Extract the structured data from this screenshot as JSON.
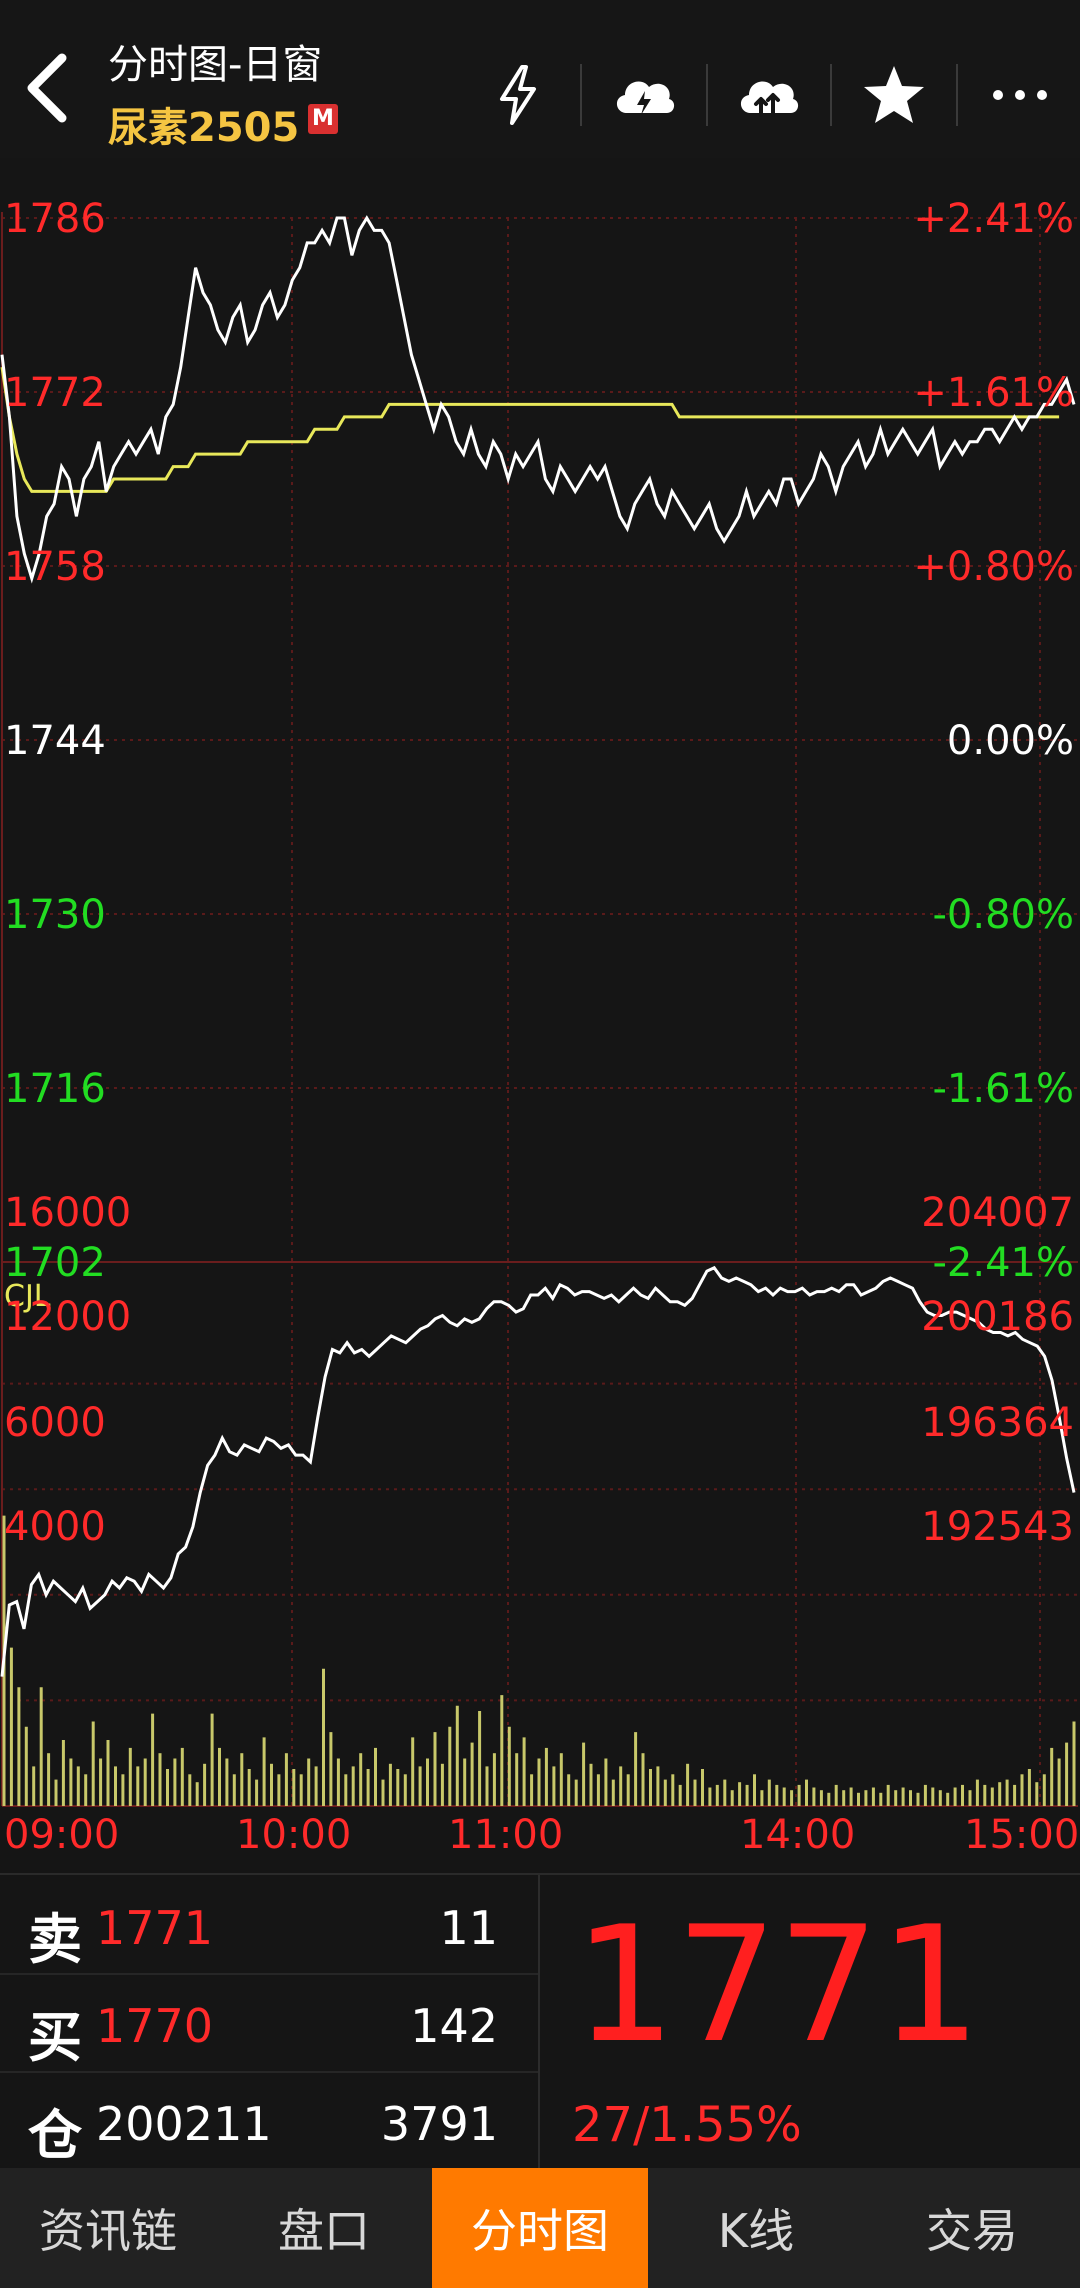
{
  "header": {
    "title": "分时图-日窗",
    "symbol": "尿素2505",
    "badge": "M",
    "icons": [
      "back-icon",
      "lightning-icon",
      "cloud-download-icon",
      "cloud-upload-icon",
      "star-icon",
      "more-icon"
    ]
  },
  "colors": {
    "background": "#151515",
    "up": "#ff2a2a",
    "down": "#22dd22",
    "neutral": "#ffffff",
    "avg_line": "#e8e85a",
    "accent": "#ff7a00",
    "symbol": "#f5c542"
  },
  "chart_data": [
    {
      "type": "line",
      "name": "price-chart",
      "y_ticks": [
        "1786",
        "1772",
        "1758",
        "1744",
        "1730",
        "1716",
        "1702"
      ],
      "right_ticks": [
        "+2.41%",
        "+1.61%",
        "+0.80%",
        "0.00%",
        "-0.80%",
        "-1.61%",
        "-2.41%"
      ],
      "ylim": [
        1702,
        1786
      ],
      "prev_settle": 1744,
      "x_ticks": [
        "09:00",
        "10:00",
        "11:00",
        "14:00",
        "15:00"
      ],
      "series": [
        {
          "values": [
            1775,
            1770,
            1762,
            1759,
            1757,
            1759,
            1762,
            1763,
            1766,
            1765,
            1762,
            1765,
            1766,
            1768,
            1764,
            1766,
            1767,
            1768,
            1767,
            1768,
            1769,
            1767,
            1770,
            1771,
            1774,
            1778,
            1782,
            1780,
            1779,
            1777,
            1776,
            1778,
            1779,
            1776,
            1777,
            1779,
            1780,
            1778,
            1779,
            1781,
            1782,
            1784,
            1784,
            1785,
            1784,
            1786,
            1786,
            1783,
            1785,
            1786,
            1785,
            1785,
            1784,
            1781,
            1778,
            1775,
            1773,
            1771,
            1769,
            1771,
            1770,
            1768,
            1767,
            1769,
            1767,
            1766,
            1768,
            1767,
            1765,
            1767,
            1766,
            1767,
            1768,
            1765,
            1764,
            1766,
            1765,
            1764,
            1765,
            1766,
            1765,
            1766,
            1764,
            1762,
            1761,
            1763,
            1764,
            1765,
            1763,
            1762,
            1764,
            1763,
            1762,
            1761,
            1762,
            1763,
            1761,
            1760,
            1761,
            1762,
            1764,
            1762,
            1763,
            1764,
            1763,
            1765,
            1765,
            1763,
            1764,
            1765,
            1767,
            1766,
            1764,
            1766,
            1767,
            1768,
            1766,
            1767,
            1769,
            1767,
            1768,
            1769,
            1768,
            1767,
            1768,
            1769,
            1766,
            1767,
            1768,
            1767,
            1768,
            1768,
            1769,
            1769,
            1768,
            1769,
            1770,
            1769,
            1770,
            1770,
            1771,
            1771,
            1772,
            1773,
            1771
          ],
          "color": "#ffffff"
        },
        {
          "values": [
            1774,
            1770,
            1767,
            1765,
            1764,
            1764,
            1764,
            1764,
            1764,
            1764,
            1764,
            1764,
            1764,
            1764,
            1764,
            1765,
            1765,
            1765,
            1765,
            1765,
            1765,
            1765,
            1765,
            1766,
            1766,
            1766,
            1767,
            1767,
            1767,
            1767,
            1767,
            1767,
            1767,
            1768,
            1768,
            1768,
            1768,
            1768,
            1768,
            1768,
            1768,
            1768,
            1769,
            1769,
            1769,
            1769,
            1770,
            1770,
            1770,
            1770,
            1770,
            1770,
            1771,
            1771,
            1771,
            1771,
            1771,
            1771,
            1771,
            1771,
            1771,
            1771,
            1771,
            1771,
            1771,
            1771,
            1771,
            1771,
            1771,
            1771,
            1771,
            1771,
            1771,
            1771,
            1771,
            1771,
            1771,
            1771,
            1771,
            1771,
            1771,
            1771,
            1771,
            1771,
            1771,
            1771,
            1771,
            1771,
            1771,
            1771,
            1771,
            1770,
            1770,
            1770,
            1770,
            1770,
            1770,
            1770,
            1770,
            1770,
            1770,
            1770,
            1770,
            1770,
            1770,
            1770,
            1770,
            1770,
            1770,
            1770,
            1770,
            1770,
            1770,
            1770,
            1770,
            1770,
            1770,
            1770,
            1770,
            1770,
            1770,
            1770,
            1770,
            1770,
            1770,
            1770,
            1770,
            1770,
            1770,
            1770,
            1770,
            1770,
            1770,
            1770,
            1770,
            1770,
            1770,
            1770,
            1770,
            1770,
            1770,
            1770,
            1770
          ],
          "color": "#e8e85a"
        }
      ]
    },
    {
      "type": "bar",
      "name": "volume-chart",
      "label": "CJL",
      "left_ticks": [
        "16000",
        "12000",
        "6000",
        "4000"
      ],
      "left_ylim": [
        0,
        20000
      ],
      "left_tick_values": [
        16000,
        12000,
        8000,
        4000
      ],
      "values": [
        11000,
        6000,
        4500,
        3000,
        1500,
        4500,
        2000,
        1000,
        2500,
        1800,
        1500,
        1200,
        3200,
        1800,
        2500,
        1500,
        1200,
        2200,
        1500,
        1800,
        3500,
        2000,
        1400,
        1800,
        2200,
        1200,
        900,
        1600,
        3500,
        2200,
        1800,
        1200,
        2000,
        1400,
        1000,
        2600,
        1600,
        1200,
        2000,
        1400,
        1200,
        1800,
        1500,
        5200,
        2800,
        1800,
        1200,
        1500,
        2000,
        1400,
        2200,
        1000,
        1600,
        1400,
        1200,
        2600,
        1500,
        1800,
        2800,
        1600,
        3000,
        3800,
        1800,
        2400,
        3600,
        1500,
        2000,
        4200,
        3000,
        2000,
        2600,
        1200,
        1800,
        2200,
        1500,
        2000,
        1200,
        1000,
        2400,
        1600,
        1200,
        1800,
        1000,
        1500,
        1200,
        2800,
        2000,
        1400,
        1500,
        1000,
        1200,
        800,
        1600,
        1000,
        1400,
        700,
        800,
        1000,
        600,
        900,
        800,
        1200,
        600,
        1000,
        800,
        700,
        600,
        800,
        1000,
        700,
        600,
        500,
        800,
        600,
        700,
        500,
        600,
        700,
        500,
        800,
        600,
        700,
        600,
        500,
        800,
        700,
        600,
        500,
        700,
        800,
        600,
        1000,
        800,
        700,
        900,
        1000,
        800,
        1200,
        1400,
        900,
        1200,
        2200,
        1800,
        2400,
        3200
      ]
    },
    {
      "type": "line",
      "name": "open-interest-chart",
      "right_ticks": [
        "204007",
        "200186",
        "196364",
        "192543"
      ],
      "ylim": [
        191000,
        206500
      ],
      "values": [
        194800,
        196900,
        197000,
        196200,
        197500,
        197800,
        197200,
        197600,
        197400,
        197200,
        197000,
        197400,
        196800,
        197000,
        197200,
        197600,
        197400,
        197700,
        197600,
        197300,
        197800,
        197600,
        197400,
        197700,
        198400,
        198600,
        199200,
        200200,
        201000,
        201300,
        201800,
        201400,
        201300,
        201600,
        201500,
        201400,
        201800,
        201700,
        201500,
        201600,
        201300,
        201300,
        201100,
        202400,
        203600,
        204400,
        204300,
        204600,
        204300,
        204400,
        204200,
        204400,
        204600,
        204800,
        204700,
        204600,
        204800,
        205000,
        205100,
        205300,
        205400,
        205200,
        205100,
        205300,
        205200,
        205300,
        205600,
        205800,
        205800,
        205700,
        205500,
        205600,
        206000,
        206000,
        206200,
        205900,
        206300,
        206200,
        206000,
        206100,
        206100,
        206000,
        205900,
        206000,
        205800,
        206000,
        206200,
        206000,
        205900,
        206200,
        206000,
        205800,
        205800,
        205700,
        205900,
        206300,
        206700,
        206800,
        206500,
        206400,
        206500,
        206400,
        206300,
        206100,
        206200,
        206000,
        206200,
        206100,
        206100,
        206200,
        206000,
        206100,
        206100,
        206200,
        206100,
        206300,
        206300,
        206000,
        206100,
        206200,
        206400,
        206500,
        206400,
        206300,
        206200,
        205800,
        205500,
        205400,
        205400,
        205500,
        205500,
        205400,
        205300,
        205200,
        205000,
        204900,
        204900,
        204800,
        204900,
        204700,
        204600,
        204500,
        204200,
        203500,
        202400,
        201200,
        200200
      ],
      "color": "#ffffff"
    }
  ],
  "quote": {
    "rows": [
      {
        "char": "卖",
        "price": "1771",
        "vol": "11"
      },
      {
        "char": "买",
        "price": "1770",
        "vol": "142"
      },
      {
        "char": "仓",
        "price": "200211",
        "vol": "3791"
      }
    ],
    "last_price": "1771",
    "change": "27/1.55%"
  },
  "tabs": [
    {
      "label": "资讯链",
      "active": false
    },
    {
      "label": "盘口",
      "active": false
    },
    {
      "label": "分时图",
      "active": true
    },
    {
      "label": "K线",
      "active": false
    },
    {
      "label": "交易",
      "active": false
    }
  ]
}
